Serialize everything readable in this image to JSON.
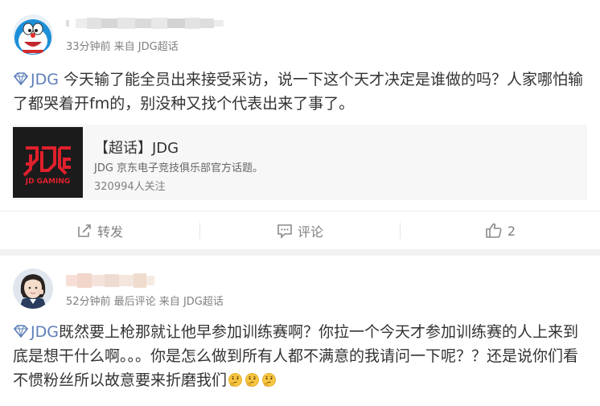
{
  "post1": {
    "author_name": "",
    "meta": "33分钟前 来自 JDG超话",
    "topic_tag": "JDG",
    "text": " 今天输了能全员出来接受采访，说一下这个天才决定是谁做的吗？人家哪怕输了都哭着开fm的，别没种又找个代表出来了事了。",
    "card": {
      "logo_text": "JD GAMING",
      "title": "【超话】JDG",
      "description": "JDG 京东电子竞技俱乐部官方话题。",
      "followers": "320994人关注"
    },
    "actions": {
      "repost_label": "转发",
      "comment_label": "评论",
      "like_count": "2"
    }
  },
  "post2": {
    "author_name": "",
    "meta": "52分钟前 最后评论 来自 JDG超话",
    "topic_tag": "JDG",
    "text": "既然要上枪那就让他早参加训练赛啊？你拉一个今天才参加训练赛的人上来到底是想干什么啊。。。你是怎么做到所有人都不满意的我请问一下呢？？还是说你们看不惯粉丝所以故意要来折磨我们",
    "emoji_count": 3
  },
  "colors": {
    "topic_blue": "#5d7fb8",
    "meta_gray": "#808080",
    "jdg_red": "#e0202c"
  }
}
